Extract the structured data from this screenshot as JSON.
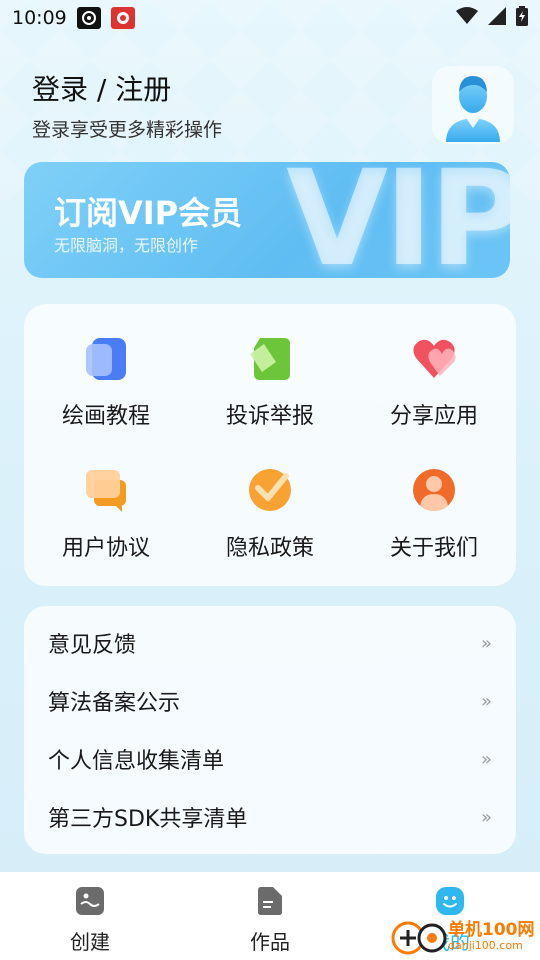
{
  "status_bar": {
    "time": "10:09"
  },
  "header": {
    "title": "登录 / 注册",
    "subtitle": "登录享受更多精彩操作"
  },
  "vip": {
    "title": "订阅VIP会员",
    "subtitle": "无限脑洞，无限创作",
    "big_text": "VIP"
  },
  "grid": {
    "items": [
      {
        "label": "绘画教程",
        "icon": "book-icon"
      },
      {
        "label": "投诉举报",
        "icon": "flag-icon"
      },
      {
        "label": "分享应用",
        "icon": "heart-icon"
      },
      {
        "label": "用户协议",
        "icon": "chat-icon"
      },
      {
        "label": "隐私政策",
        "icon": "check-icon"
      },
      {
        "label": "关于我们",
        "icon": "person-icon"
      }
    ]
  },
  "list": {
    "items": [
      {
        "label": "意见反馈",
        "chevron": "»"
      },
      {
        "label": "算法备案公示",
        "chevron": "»"
      },
      {
        "label": "个人信息收集清单",
        "chevron": "»"
      },
      {
        "label": "第三方SDK共享清单",
        "chevron": "»"
      }
    ]
  },
  "nav": {
    "items": [
      {
        "label": "创建",
        "icon": "image-icon"
      },
      {
        "label": "作品",
        "icon": "document-icon"
      },
      {
        "label": "我的",
        "icon": "smile-icon"
      }
    ]
  },
  "watermark": {
    "line1": "单机100网",
    "line2": "danji100.com"
  },
  "colors": {
    "accent": "#5fbdf3",
    "background": "#e6f7fd",
    "orange": "#f59a23"
  }
}
